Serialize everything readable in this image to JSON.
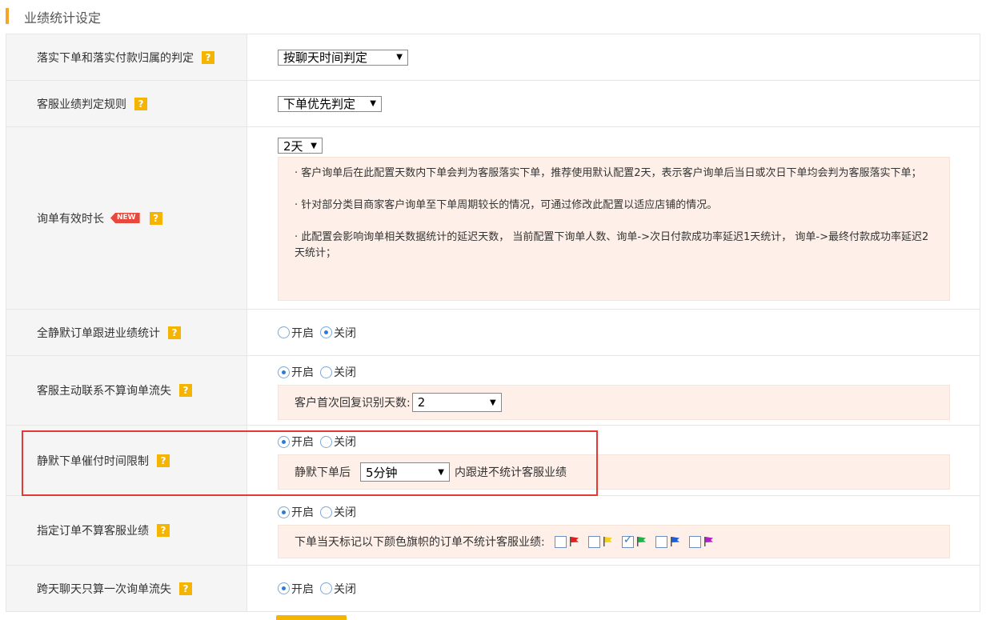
{
  "section": {
    "title": "业绩统计设定"
  },
  "rows": {
    "order_attribution": {
      "label": "落实下单和落实付款归属的判定",
      "help": "?",
      "select": "按聊天时间判定"
    },
    "rule": {
      "label": "客服业绩判定规则",
      "help": "?",
      "select": "下单优先判定"
    },
    "inquiry_duration": {
      "label": "询单有效时长",
      "badge": "NEW",
      "help": "?",
      "select": "2天",
      "notes": [
        "· 客户询单后在此配置天数内下单会判为客服落实下单，推荐使用默认配置2天，表示客户询单后当日或次日下单均会判为客服落实下单；",
        "· 针对部分类目商家客户询单至下单周期较长的情况，可通过修改此配置以适应店铺的情况。",
        "· 此配置会影响询单相关数据统计的延迟天数， 当前配置下询单人数、询单->次日付款成功率延迟1天统计， 询单->最终付款成功率延迟2天统计；"
      ]
    },
    "silent_follow": {
      "label": "全静默订单跟进业绩统计",
      "help": "?",
      "options": [
        "开启",
        "关闭"
      ],
      "selected": "关闭"
    },
    "active_contact": {
      "label": "客服主动联系不算询单流失",
      "help": "?",
      "options": [
        "开启",
        "关闭"
      ],
      "selected": "开启",
      "sub_label": "客户首次回复识别天数:",
      "sub_select": "2"
    },
    "silent_payment_limit": {
      "label": "静默下单催付时间限制",
      "help": "?",
      "options": [
        "开启",
        "关闭"
      ],
      "selected": "开启",
      "prefix": "静默下单后",
      "select": "5分钟",
      "suffix": "内跟进不统计客服业绩"
    },
    "designated_orders": {
      "label": "指定订单不算客服业绩",
      "help": "?",
      "options": [
        "开启",
        "关闭"
      ],
      "selected": "开启",
      "flags_label": "下单当天标记以下颜色旗帜的订单不统计客服业绩:",
      "flags": [
        {
          "icon": "red-flag-icon",
          "color": "#e02020",
          "checked": false
        },
        {
          "icon": "yellow-flag-icon",
          "color": "#f2d11b",
          "checked": false
        },
        {
          "icon": "green-flag-icon",
          "color": "#22b24c",
          "checked": true
        },
        {
          "icon": "blue-flag-icon",
          "color": "#1f5fd6",
          "checked": false
        },
        {
          "icon": "purple-flag-icon",
          "color": "#b31fc7",
          "checked": false
        }
      ]
    },
    "cross_day": {
      "label": "跨天聊天只算一次询单流失",
      "help": "?",
      "options": [
        "开启",
        "关闭"
      ],
      "selected": "开启"
    }
  },
  "colors": {
    "accent": "#f5a623",
    "help": "#f5b400",
    "panel": "#fef0e8",
    "highlight": "#e53935"
  }
}
